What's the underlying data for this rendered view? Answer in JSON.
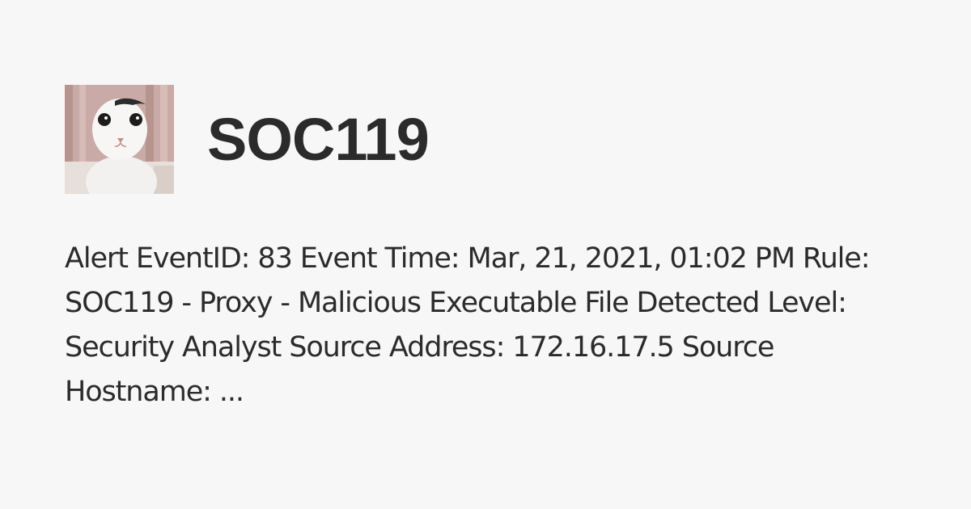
{
  "card": {
    "avatar_icon": "white-cat-avatar-icon",
    "title": "SOC119",
    "excerpt": "Alert EventID: 83 Event Time: Mar, 21, 2021, 01:02 PM Rule: SOC119 - Proxy - Malicious Executable File Detected Level: Security Analyst Source Address: 172.16.17.5 Source Hostname: ..."
  },
  "colors": {
    "background": "#f8f7f8",
    "text": "#2b2b2b"
  }
}
